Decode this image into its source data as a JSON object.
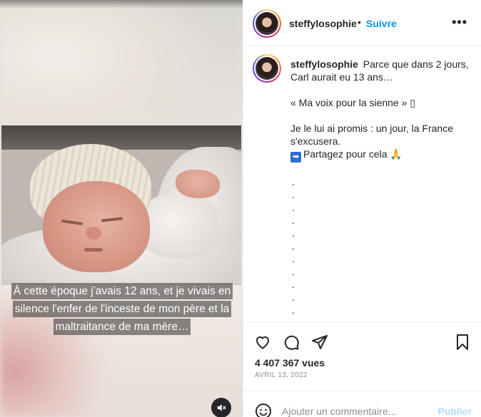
{
  "media": {
    "caption_lines": [
      "À cette époque j'avais 12 ans, et je vivais en",
      "silence l'enfer de l'inceste de mon père et la",
      "maltraitance de ma mère…"
    ],
    "mute_icon": "muted-speaker-icon"
  },
  "header": {
    "username": "steffylosophie",
    "separator": "•",
    "follow_label": "Suivre",
    "more_label": "•••"
  },
  "caption": {
    "username": "steffylosophie",
    "line1": "Parce que dans 2 jours, Carl aurait eu 13 ans…",
    "line2": "« Ma voix pour la sienne » ▯",
    "line3": "Je le lui ai promis : un jour, la France s'excusera.",
    "line4_arrow": "➡",
    "line4": "Partagez pour cela 🙏",
    "bullets": [
      ".",
      ".",
      ".",
      ".",
      ".",
      ".",
      ".",
      ".",
      ".",
      ".",
      ".",
      ".",
      "."
    ]
  },
  "actions": {
    "icons": [
      "heart-icon",
      "comment-icon",
      "share-icon",
      "bookmark-icon"
    ],
    "views": "4 407 367 vues",
    "date": "AVRIL 13, 2022"
  },
  "comment": {
    "placeholder": "Ajouter un commentaire...",
    "publish_label": "Publier"
  },
  "colors": {
    "accent": "#0095f6",
    "publish_disabled": "#b2dffc",
    "muted_text": "#8e8e8e",
    "text": "#262626"
  }
}
